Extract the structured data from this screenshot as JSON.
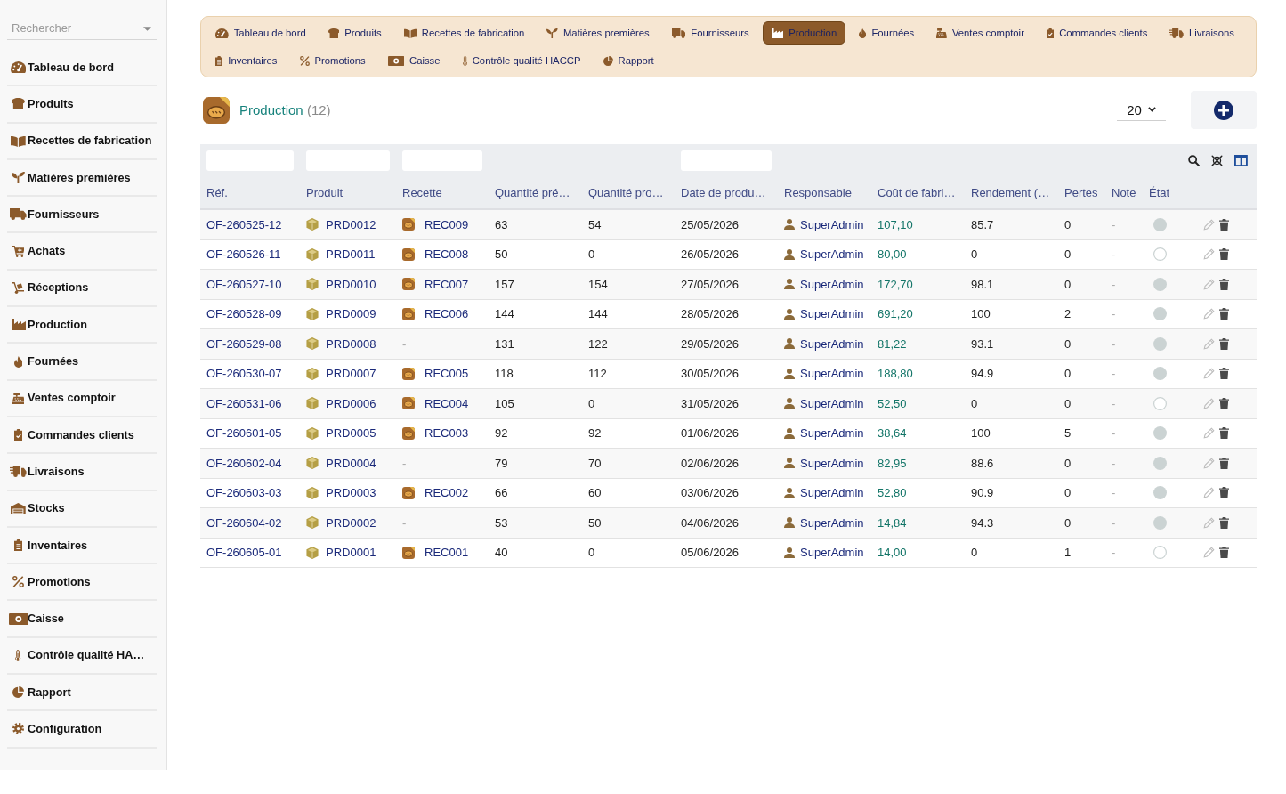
{
  "sidebar": {
    "search": {
      "placeholder": "Rechercher"
    },
    "items": [
      {
        "label": "Tableau de bord",
        "selected": false
      },
      {
        "label": "Produits",
        "selected": false
      },
      {
        "label": "Recettes de fabrication",
        "selected": false
      },
      {
        "label": "Matières premières",
        "selected": false
      },
      {
        "label": "Fournisseurs",
        "selected": false
      },
      {
        "label": "Achats",
        "selected": false
      },
      {
        "label": "Réceptions",
        "selected": false
      },
      {
        "label": "Production",
        "selected": false
      },
      {
        "label": "Fournées",
        "selected": false
      },
      {
        "label": "Ventes comptoir",
        "selected": false
      },
      {
        "label": "Commandes clients",
        "selected": false
      },
      {
        "label": "Livraisons",
        "selected": false
      },
      {
        "label": "Stocks",
        "selected": false
      },
      {
        "label": "Inventaires",
        "selected": false
      },
      {
        "label": "Promotions",
        "selected": false
      },
      {
        "label": "Caisse",
        "selected": false
      },
      {
        "label": "Contrôle qualité HA…",
        "selected": false
      },
      {
        "label": "Rapport",
        "selected": false
      },
      {
        "label": "Configuration",
        "selected": false
      }
    ]
  },
  "nav": {
    "items": [
      {
        "label": "Tableau de bord",
        "selected": false
      },
      {
        "label": "Produits",
        "selected": false
      },
      {
        "label": "Recettes de fabrication",
        "selected": false
      },
      {
        "label": "Matières premières",
        "selected": false
      },
      {
        "label": "Fournisseurs",
        "selected": false
      },
      {
        "label": "Production",
        "selected": true
      },
      {
        "label": "Fournées",
        "selected": false
      },
      {
        "label": "Ventes comptoir",
        "selected": false
      },
      {
        "label": "Commandes clients",
        "selected": false
      },
      {
        "label": "Livraisons",
        "selected": false
      },
      {
        "label": "Inventaires",
        "selected": false
      },
      {
        "label": "Promotions",
        "selected": false
      },
      {
        "label": "Caisse",
        "selected": false
      },
      {
        "label": "Contrôle qualité HACCP",
        "selected": false
      },
      {
        "label": "Rapport",
        "selected": false
      }
    ]
  },
  "header": {
    "title": "Production",
    "count": "(12)",
    "page_size": "20"
  },
  "table": {
    "columns": [
      {
        "label": "Réf.",
        "filter": true
      },
      {
        "label": "Produit",
        "filter": true
      },
      {
        "label": "Recette",
        "filter": true
      },
      {
        "label": "Quantité pré…",
        "filter": false
      },
      {
        "label": "Quantité pro…",
        "filter": false
      },
      {
        "label": "Date de produ…",
        "filter": true
      },
      {
        "label": "Responsable",
        "filter": false
      },
      {
        "label": "Coût de fabri…",
        "filter": false
      },
      {
        "label": "Rendement (…",
        "filter": false
      },
      {
        "label": "Pertes",
        "filter": false
      },
      {
        "label": "Note",
        "filter": false
      },
      {
        "label": "État",
        "filter": false
      }
    ],
    "rows": [
      {
        "ref": "OF-260525-12",
        "product": "PRD0012",
        "recipe": {
          "kind": "link",
          "text": "REC009"
        },
        "qty_planned": "63",
        "qty_produced": "54",
        "date": "25/05/2026",
        "responsible": "SuperAdmin",
        "cost": "107,10",
        "yield": "85.7",
        "losses": "0",
        "note": "-",
        "status_filled": true
      },
      {
        "ref": "OF-260526-11",
        "product": "PRD0011",
        "recipe": {
          "kind": "link",
          "text": "REC008"
        },
        "qty_planned": "50",
        "qty_produced": "0",
        "date": "26/05/2026",
        "responsible": "SuperAdmin",
        "cost": "80,00",
        "yield": "0",
        "losses": "0",
        "note": "-",
        "status_filled": false
      },
      {
        "ref": "OF-260527-10",
        "product": "PRD0010",
        "recipe": {
          "kind": "link",
          "text": "REC007"
        },
        "qty_planned": "157",
        "qty_produced": "154",
        "date": "27/05/2026",
        "responsible": "SuperAdmin",
        "cost": "172,70",
        "yield": "98.1",
        "losses": "0",
        "note": "-",
        "status_filled": true
      },
      {
        "ref": "OF-260528-09",
        "product": "PRD0009",
        "recipe": {
          "kind": "link",
          "text": "REC006"
        },
        "qty_planned": "144",
        "qty_produced": "144",
        "date": "28/05/2026",
        "responsible": "SuperAdmin",
        "cost": "691,20",
        "yield": "100",
        "losses": "2",
        "note": "-",
        "status_filled": true
      },
      {
        "ref": "OF-260529-08",
        "product": "PRD0008",
        "recipe": {
          "kind": "empty",
          "text": "-"
        },
        "qty_planned": "131",
        "qty_produced": "122",
        "date": "29/05/2026",
        "responsible": "SuperAdmin",
        "cost": "81,22",
        "yield": "93.1",
        "losses": "0",
        "note": "-",
        "status_filled": true
      },
      {
        "ref": "OF-260530-07",
        "product": "PRD0007",
        "recipe": {
          "kind": "link",
          "text": "REC005"
        },
        "qty_planned": "118",
        "qty_produced": "112",
        "date": "30/05/2026",
        "responsible": "SuperAdmin",
        "cost": "188,80",
        "yield": "94.9",
        "losses": "0",
        "note": "-",
        "status_filled": true
      },
      {
        "ref": "OF-260531-06",
        "product": "PRD0006",
        "recipe": {
          "kind": "link",
          "text": "REC004"
        },
        "qty_planned": "105",
        "qty_produced": "0",
        "date": "31/05/2026",
        "responsible": "SuperAdmin",
        "cost": "52,50",
        "yield": "0",
        "losses": "0",
        "note": "-",
        "status_filled": false
      },
      {
        "ref": "OF-260601-05",
        "product": "PRD0005",
        "recipe": {
          "kind": "link",
          "text": "REC003"
        },
        "qty_planned": "92",
        "qty_produced": "92",
        "date": "01/06/2026",
        "responsible": "SuperAdmin",
        "cost": "38,64",
        "yield": "100",
        "losses": "5",
        "note": "-",
        "status_filled": true
      },
      {
        "ref": "OF-260602-04",
        "product": "PRD0004",
        "recipe": {
          "kind": "empty",
          "text": "-"
        },
        "qty_planned": "79",
        "qty_produced": "70",
        "date": "02/06/2026",
        "responsible": "SuperAdmin",
        "cost": "82,95",
        "yield": "88.6",
        "losses": "0",
        "note": "-",
        "status_filled": true
      },
      {
        "ref": "OF-260603-03",
        "product": "PRD0003",
        "recipe": {
          "kind": "link",
          "text": "REC002"
        },
        "qty_planned": "66",
        "qty_produced": "60",
        "date": "03/06/2026",
        "responsible": "SuperAdmin",
        "cost": "52,80",
        "yield": "90.9",
        "losses": "0",
        "note": "-",
        "status_filled": true
      },
      {
        "ref": "OF-260604-02",
        "product": "PRD0002",
        "recipe": {
          "kind": "empty",
          "text": "-"
        },
        "qty_planned": "53",
        "qty_produced": "50",
        "date": "04/06/2026",
        "responsible": "SuperAdmin",
        "cost": "14,84",
        "yield": "94.3",
        "losses": "0",
        "note": "-",
        "status_filled": true
      },
      {
        "ref": "OF-260605-01",
        "product": "PRD0001",
        "recipe": {
          "kind": "link",
          "text": "REC001"
        },
        "qty_planned": "40",
        "qty_produced": "0",
        "date": "05/06/2026",
        "responsible": "SuperAdmin",
        "cost": "14,00",
        "yield": "0",
        "losses": "1",
        "note": "-",
        "status_filled": false
      }
    ]
  }
}
